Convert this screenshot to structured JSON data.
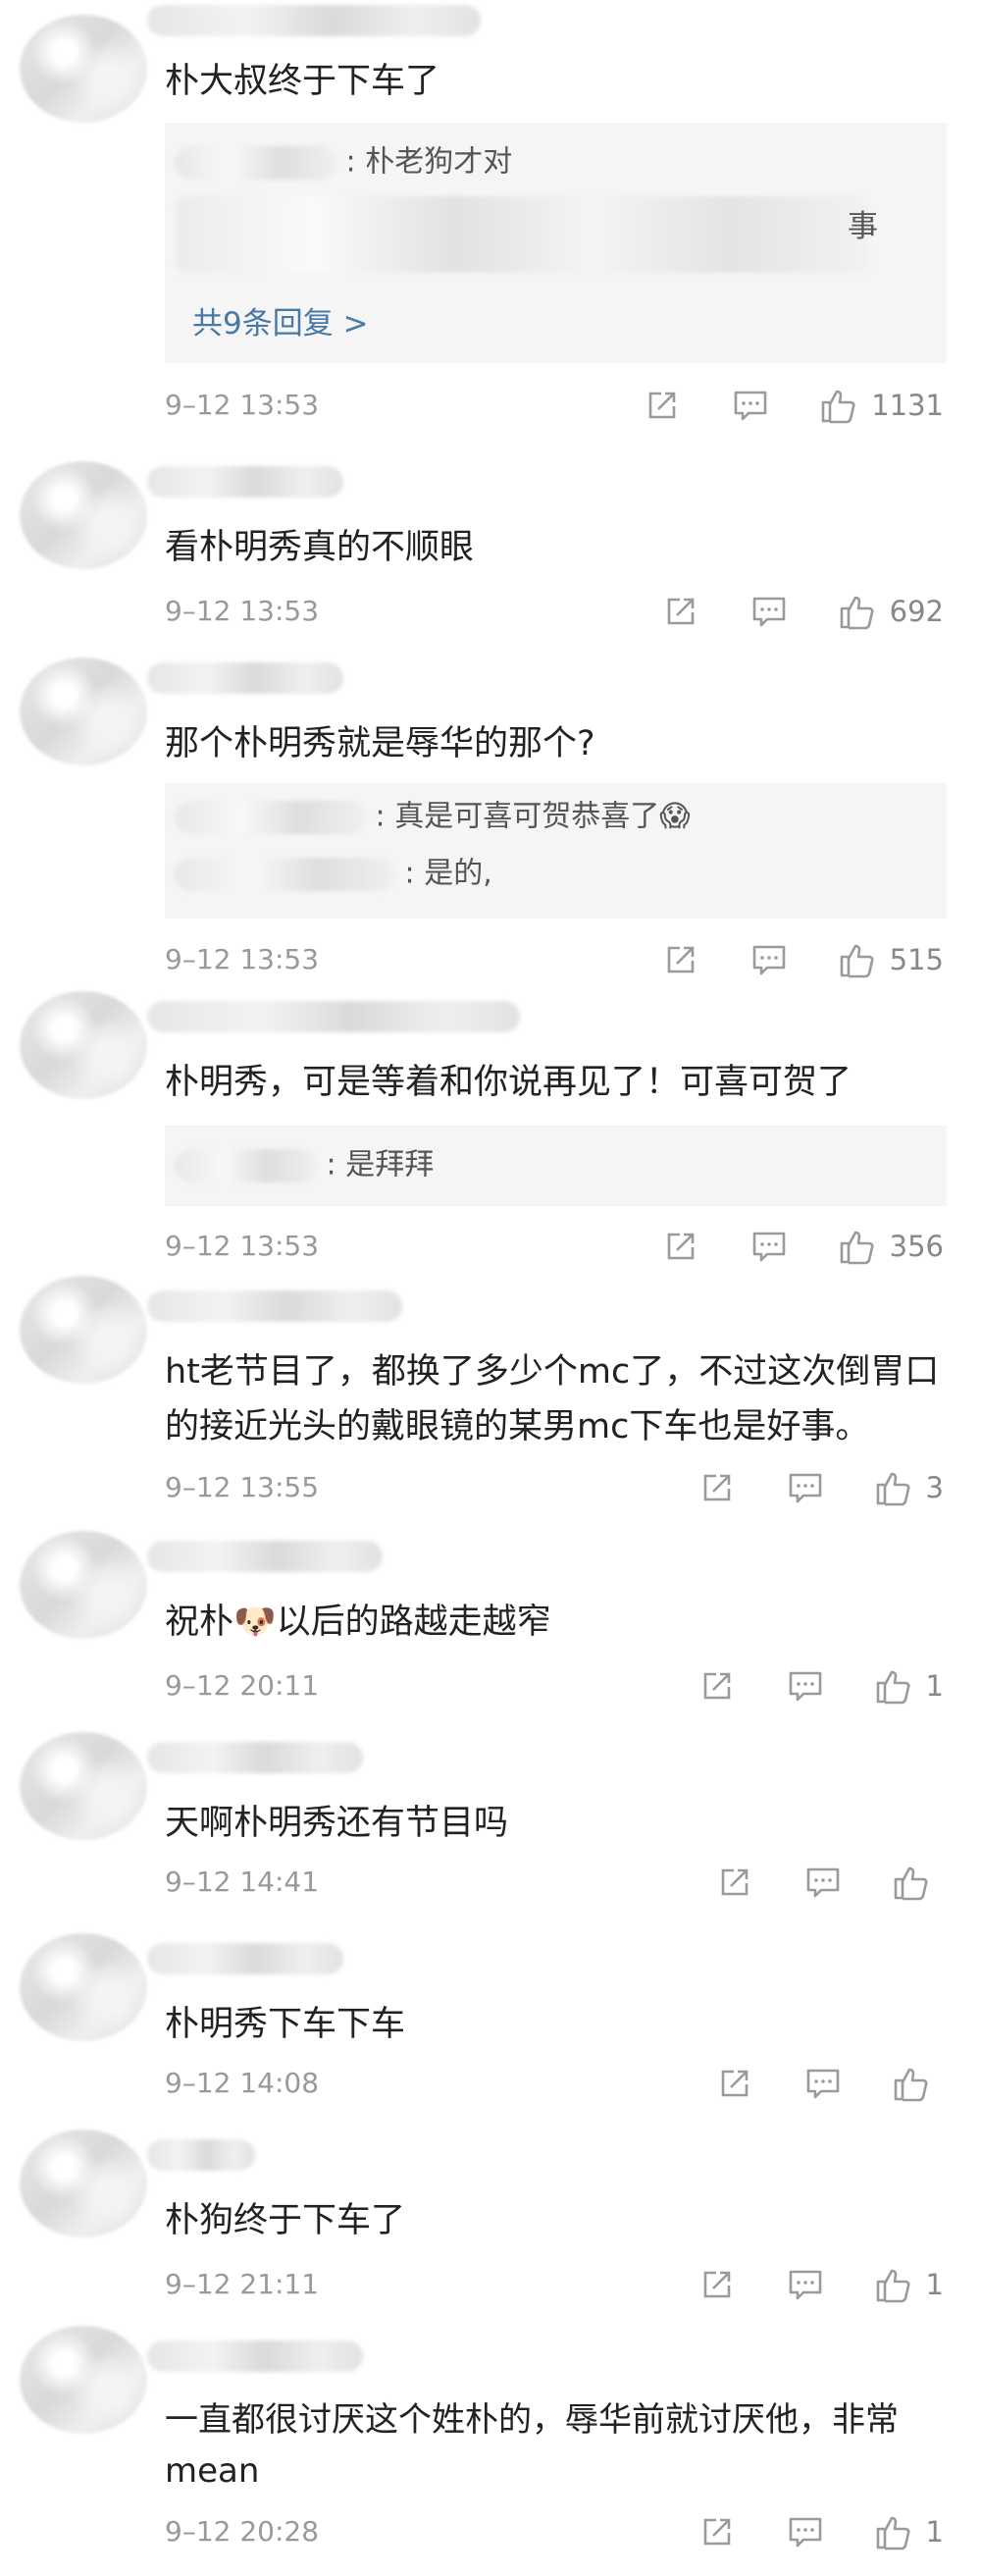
{
  "colors": {
    "link": "#4a78a6",
    "time": "#999999",
    "reply_bg": "#f5f5f5",
    "icon": "#9a9a9a"
  },
  "icons": {
    "share": "share-icon",
    "comment": "comment-icon",
    "like": "thumbs-up-icon"
  },
  "comments": [
    {
      "text": "朴大叔终于下车了",
      "replies": [
        {
          "content": ": 朴老狗才对"
        }
      ],
      "replies_trailing_char": "事",
      "more_link": "共9条回复 >",
      "time": "9–12 13:53",
      "likes": "1131"
    },
    {
      "text": "看朴明秀真的不顺眼",
      "time": "9–12 13:53",
      "likes": "692"
    },
    {
      "text": "那个朴明秀就是辱华的那个?",
      "replies": [
        {
          "content": ": 真是可喜可贺恭喜了😱"
        },
        {
          "content": ": 是的,"
        }
      ],
      "time": "9–12 13:53",
      "likes": "515"
    },
    {
      "text": "朴明秀，可是等着和你说再见了！可喜可贺了",
      "replies": [
        {
          "content": ": 是拜拜"
        }
      ],
      "time": "9–12 13:53",
      "likes": "356"
    },
    {
      "text": "ht老节目了，都换了多少个mc了，不过这次倒胃口的接近光头的戴眼镜的某男mc下车也是好事。",
      "time": "9–12 13:55",
      "likes": "3"
    },
    {
      "text": "祝朴🐶以后的路越走越窄",
      "time": "9–12 20:11",
      "likes": "1"
    },
    {
      "text": "天啊朴明秀还有节目吗",
      "time": "9–12 14:41",
      "likes": ""
    },
    {
      "text": "朴明秀下车下车",
      "time": "9–12 14:08",
      "likes": ""
    },
    {
      "text": "朴狗终于下车了",
      "time": "9–12 21:11",
      "likes": "1"
    },
    {
      "text": "一直都很讨厌这个姓朴的，辱华前就讨厌他，非常mean",
      "time": "9–12 20:28",
      "likes": "1"
    }
  ]
}
